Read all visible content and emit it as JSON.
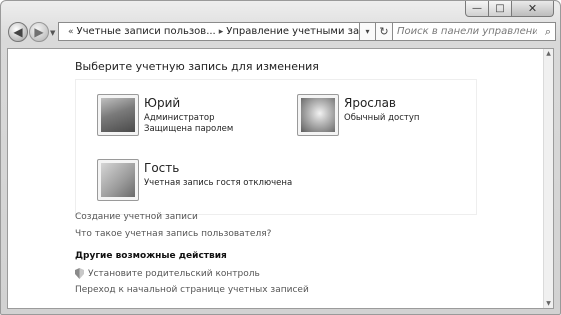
{
  "title_bar": {
    "minimize_glyph": "—",
    "maximize_glyph": "□",
    "close_glyph": "✕"
  },
  "nav": {
    "back_glyph": "◀",
    "forward_glyph": "▶",
    "breadcrumb_prefix": "«",
    "breadcrumb": [
      "Учетные записи пользов...",
      "Управление учетными записями"
    ],
    "address_dropdown_glyph": "▾",
    "refresh_glyph": "↻",
    "search_placeholder": "Поиск в панели управления",
    "search_icon": "search-icon"
  },
  "main": {
    "heading": "Выберите учетную запись для изменения",
    "accounts": [
      {
        "name": "Юрий",
        "details": [
          "Администратор",
          "Защищена паролем"
        ],
        "picture": "chess-picture"
      },
      {
        "name": "Ярослав",
        "details": [
          "Обычный доступ"
        ],
        "picture": "flower-picture"
      },
      {
        "name": "Гость",
        "details": [
          "Учетная запись гостя отключена"
        ],
        "picture": "guest-picture"
      }
    ],
    "links": {
      "create_account": "Создание учетной записи",
      "what_is_account": "Что такое учетная запись пользователя?"
    },
    "other_actions": {
      "title": "Другие возможные действия",
      "parental_control": "Установите родительский контроль",
      "go_to_main": "Переход к начальной странице учетных записей"
    }
  },
  "colors": {
    "frame": "#d6d6d6",
    "content_bg": "#ffffff",
    "link": "#555555",
    "text": "#222222"
  }
}
